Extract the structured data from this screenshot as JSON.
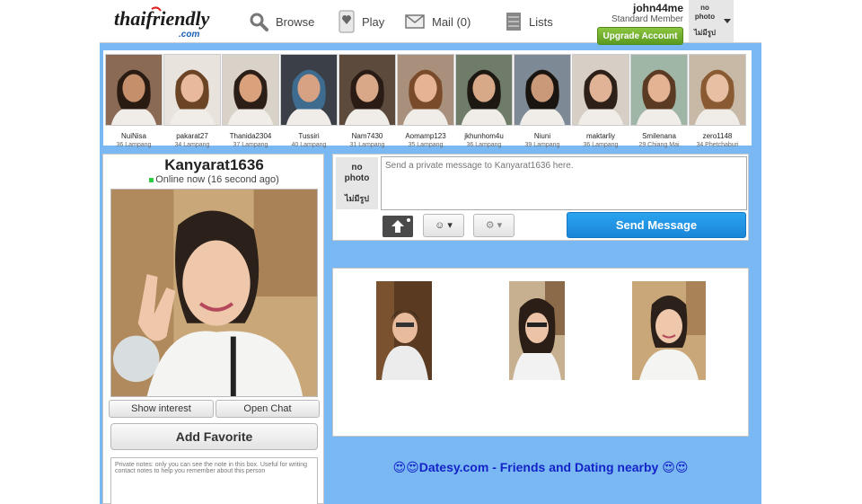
{
  "header": {
    "logo_text": "thaifriendly",
    "logo_sub": ".com",
    "nav": {
      "browse": "Browse",
      "play": "Play",
      "mail": "Mail (0)",
      "lists": "Lists"
    },
    "username": "john44me",
    "member_type": "Standard Member",
    "upgrade_label": "Upgrade Account",
    "no_photo_line1": "no",
    "no_photo_line2": "photo",
    "no_photo_thai": "ไม่มีรูป"
  },
  "members": [
    {
      "name": "NuiNisa",
      "info": "36 Lampang",
      "bg": "#8a6a55",
      "face": "#c58f6b",
      "hair": "#2a1b12"
    },
    {
      "name": "pakarat27",
      "info": "34 Lampang",
      "bg": "#e9e3dd",
      "face": "#e8b99a",
      "hair": "#6b4425"
    },
    {
      "name": "Thanida2304",
      "info": "37 Lampang",
      "bg": "#d9d2c8",
      "face": "#d9a17c",
      "hair": "#2b1e16"
    },
    {
      "name": "Tussiri",
      "info": "40 Lampang",
      "bg": "#3b3f48",
      "face": "#d6a283",
      "hair": "#3e6c8f"
    },
    {
      "name": "Nam7430",
      "info": "31 Lampang",
      "bg": "#5c4a3d",
      "face": "#d9a888",
      "hair": "#2a1c14"
    },
    {
      "name": "Aomamp123",
      "info": "35 Lampang",
      "bg": "#a9907c",
      "face": "#e6b394",
      "hair": "#7a4b2a"
    },
    {
      "name": "jkhunhom4u",
      "info": "36 Lampang",
      "bg": "#6f7c6a",
      "face": "#d7a988",
      "hair": "#1e1812"
    },
    {
      "name": "Niuni",
      "info": "39 Lampang",
      "bg": "#7d8a95",
      "face": "#c9997a",
      "hair": "#1a1410"
    },
    {
      "name": "maktarliy",
      "info": "36 Lampang",
      "bg": "#d7cfc5",
      "face": "#e1b396",
      "hair": "#2c2018"
    },
    {
      "name": "Smilenana",
      "info": "29 Chiang Mai",
      "bg": "#9fb6a6",
      "face": "#e4b394",
      "hair": "#5a3a22"
    },
    {
      "name": "zero1148",
      "info": "34 Phetchaburi",
      "bg": "#c7b9a6",
      "face": "#e7bfa3",
      "hair": "#8a5b33"
    }
  ],
  "profile": {
    "name": "Kanyarat1636",
    "status": "Online now (16 second ago)",
    "show_interest": "Show interest",
    "open_chat": "Open Chat",
    "add_favorite": "Add Favorite",
    "notes_placeholder": "Private notes: only you can see the note in this box. Useful for writing contact notes to help you remember about this person"
  },
  "message": {
    "no_photo_line1": "no",
    "no_photo_line2": "photo",
    "no_photo_thai": "ไม่มีรูป",
    "placeholder": "Send a private message to Kanyarat1636 here.",
    "emoji_label": "☺ ▾",
    "gear_label": "⚙ ▾",
    "send_label": "Send Message"
  },
  "ad": {
    "emoji_left": "😍😍",
    "text": "Datesy.com - Friends and Dating nearby",
    "emoji_right": "😍😍"
  },
  "colors": {
    "page_bg": "#79b8f2",
    "send_button": "#1f93e0",
    "upgrade_button": "#6fb02e",
    "online_dot": "#2ecc40",
    "ad_text": "#1423c8"
  }
}
